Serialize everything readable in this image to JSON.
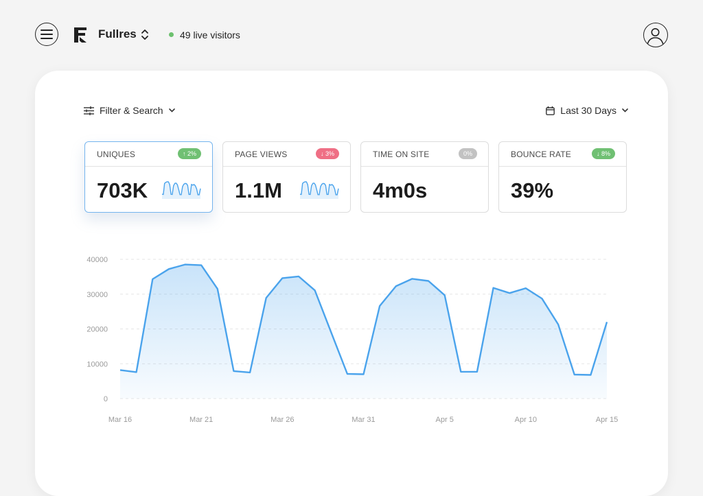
{
  "header": {
    "site_name": "Fullres",
    "live_visitors": "49 live visitors",
    "icons": {
      "menu": "menu-icon",
      "logo": "fullres-logo",
      "switch": "chevron-updown-icon",
      "user": "user-icon"
    }
  },
  "toolbar": {
    "filter_label": "Filter & Search",
    "date_range": "Last 30 Days"
  },
  "metrics": [
    {
      "label": "UNIQUES",
      "value": "703K",
      "badge": "↑ 2%",
      "trend": "up",
      "active": true
    },
    {
      "label": "PAGE VIEWS",
      "value": "1.1M",
      "badge": "↓ 3%",
      "trend": "down",
      "active": false
    },
    {
      "label": "TIME ON SITE",
      "value": "4m0s",
      "badge": "0%",
      "trend": "neutral",
      "active": false
    },
    {
      "label": "BOUNCE RATE",
      "value": "39%",
      "badge": "↓ 8%",
      "trend": "up",
      "active": false
    }
  ],
  "colors": {
    "accent": "#4aa3ec",
    "up": "#70c073",
    "down": "#ef6f85",
    "neutral": "#c2c2c2",
    "live": "#6cc06e"
  },
  "chart_data": {
    "type": "area",
    "ylim": [
      0,
      40000
    ],
    "y_ticks": [
      "0",
      "10000",
      "20000",
      "30000",
      "40000"
    ],
    "x_ticks": [
      "Mar 16",
      "Mar 21",
      "Mar 26",
      "Mar 31",
      "Apr  5",
      "Apr 10",
      "Apr 15"
    ],
    "x": [
      "Mar 16",
      "Mar 17",
      "Mar 18",
      "Mar 19",
      "Mar 20",
      "Mar 21",
      "Mar 22",
      "Mar 23",
      "Mar 24",
      "Mar 25",
      "Mar 26",
      "Mar 27",
      "Mar 28",
      "Mar 29",
      "Mar 30",
      "Mar 31",
      "Apr 1",
      "Apr 2",
      "Apr 3",
      "Apr 4",
      "Apr 5",
      "Apr 6",
      "Apr 7",
      "Apr 8",
      "Apr 9",
      "Apr 10",
      "Apr 11",
      "Apr 12",
      "Apr 13",
      "Apr 14",
      "Apr 15"
    ],
    "values": [
      8200,
      7600,
      34300,
      37200,
      38500,
      38300,
      31500,
      7900,
      7500,
      28900,
      34600,
      35100,
      31100,
      19100,
      7100,
      7000,
      26600,
      32300,
      34400,
      33800,
      29700,
      7700,
      7700,
      31800,
      30300,
      31700,
      28700,
      21300,
      6900,
      6800,
      22000
    ],
    "grid": true
  }
}
